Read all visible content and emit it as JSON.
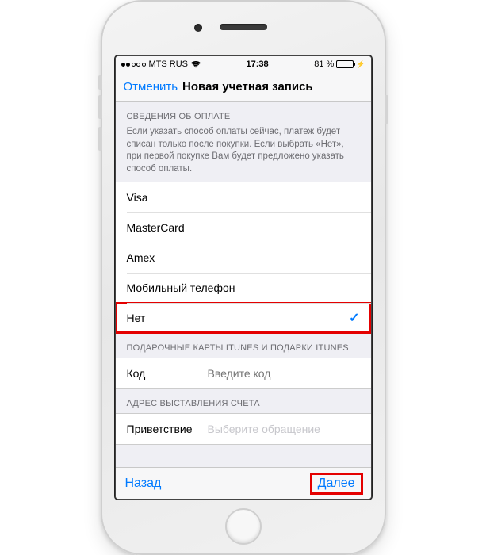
{
  "statusbar": {
    "carrier": "MTS RUS",
    "time": "17:38",
    "battery_pct": "81 %"
  },
  "navbar": {
    "cancel": "Отменить",
    "title": "Новая учетная запись"
  },
  "payment": {
    "header": "СВЕДЕНИЯ ОБ ОПЛАТЕ",
    "description": "Если указать способ оплаты сейчас, платеж будет списан только после покупки. Если выбрать «Нет», при первой покупке Вам будет предложено указать способ оплаты.",
    "options": [
      {
        "label": "Visa",
        "selected": false
      },
      {
        "label": "MasterCard",
        "selected": false
      },
      {
        "label": "Amex",
        "selected": false
      },
      {
        "label": "Мобильный телефон",
        "selected": false
      },
      {
        "label": "Нет",
        "selected": true
      }
    ]
  },
  "giftcard": {
    "header": "ПОДАРОЧНЫЕ КАРТЫ ITUNES И ПОДАРКИ ITUNES",
    "code_label": "Код",
    "code_placeholder": "Введите код"
  },
  "billing": {
    "header": "АДРЕС ВЫСТАВЛЕНИЯ СЧЕТА",
    "salutation_label": "Приветствие",
    "salutation_placeholder": "Выберите обращение"
  },
  "bottombar": {
    "back": "Назад",
    "next": "Далее"
  }
}
